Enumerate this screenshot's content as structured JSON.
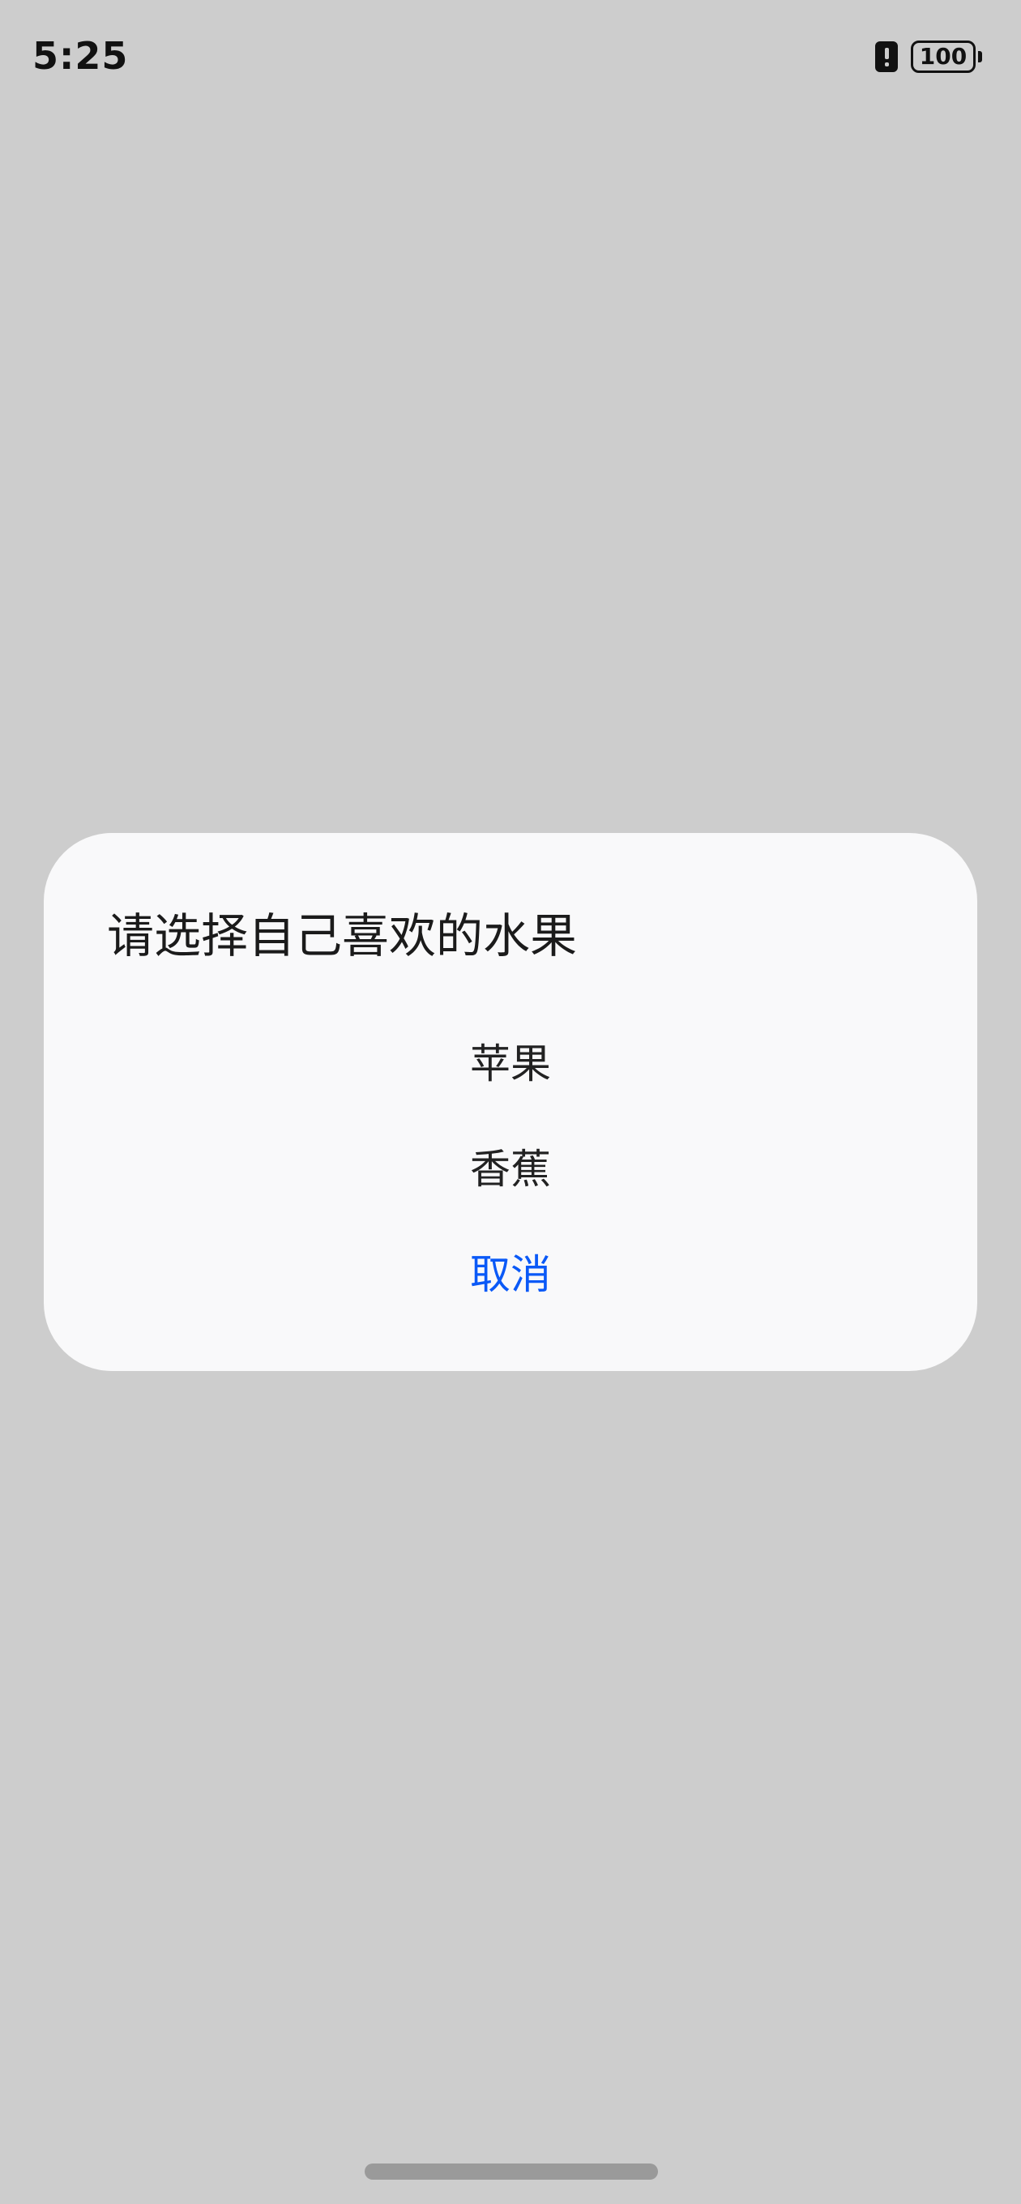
{
  "status_bar": {
    "time": "5:25",
    "battery_level": "100",
    "icons": [
      "alert-icon",
      "battery-icon"
    ]
  },
  "dialog": {
    "title": "请选择自己喜欢的水果",
    "options": [
      {
        "label": "苹果"
      },
      {
        "label": "香蕉"
      }
    ],
    "cancel_label": "取消"
  },
  "colors": {
    "background": "#cdcdcd",
    "dialog_background": "#f9f9fa",
    "accent": "#0a59f7",
    "text": "#222222"
  }
}
